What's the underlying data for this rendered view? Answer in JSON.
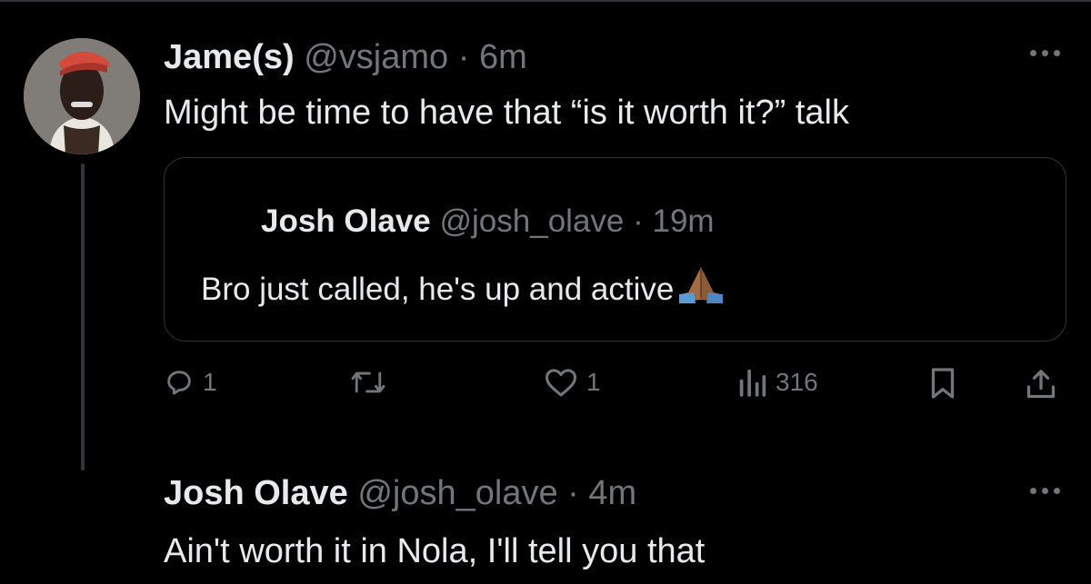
{
  "main_tweet": {
    "author_name": "Jame(s)",
    "handle": "@vsjamo",
    "separator": "·",
    "time": "6m",
    "text": "Might be time to have that “is it worth it?” talk",
    "avatar_icon": "user-avatar-photo"
  },
  "quoted_tweet": {
    "author_name": "Josh Olave",
    "handle": "@josh_olave",
    "separator": "·",
    "time": "19m",
    "text": "Bro just called, he's up and active",
    "emoji": "folded-hands-emoji"
  },
  "actions": {
    "reply_count": "1",
    "like_count": "1",
    "view_count": "316",
    "icons": [
      "reply-icon",
      "retweet-icon",
      "like-icon",
      "views-icon",
      "bookmark-icon",
      "share-icon"
    ]
  },
  "reply_tweet": {
    "author_name": "Josh Olave",
    "handle": "@josh_olave",
    "separator": "·",
    "time": "4m",
    "text": "Ain't worth it in Nola, I'll tell you that"
  },
  "colors": {
    "background": "#000000",
    "text_primary": "#e7e9ea",
    "text_secondary": "#71767b",
    "border": "#2f3336"
  }
}
